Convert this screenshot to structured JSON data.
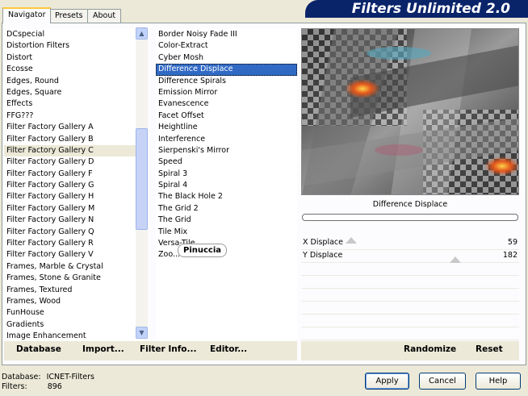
{
  "tabs": [
    {
      "label": "Navigator",
      "active": true
    },
    {
      "label": "Presets",
      "active": false
    },
    {
      "label": "About",
      "active": false
    }
  ],
  "banner": "Filters Unlimited 2.0",
  "categories": [
    "DCspecial",
    "Distortion Filters",
    "Distort",
    "Ecosse",
    "Edges, Round",
    "Edges, Square",
    "Effects",
    "FFG???",
    "Filter Factory Gallery A",
    "Filter Factory Gallery B",
    "Filter Factory Gallery C",
    "Filter Factory Gallery D",
    "Filter Factory Gallery F",
    "Filter Factory Gallery G",
    "Filter Factory Gallery H",
    "Filter Factory Gallery M",
    "Filter Factory Gallery N",
    "Filter Factory Gallery Q",
    "Filter Factory Gallery R",
    "Filter Factory Gallery V",
    "Frames, Marble & Crystal",
    "Frames, Stone & Granite",
    "Frames, Textured",
    "Frames, Wood",
    "FunHouse",
    "Gradients",
    "Image Enhancement"
  ],
  "selected_category": "Filter Factory Gallery C",
  "filters": [
    "Border Noisy Fade III",
    "Color-Extract",
    "Cyber Mosh",
    "Difference Displace",
    "Difference Spirals",
    "Emission Mirror",
    "Evanescence",
    "Facet Offset",
    "Heightline",
    "Interference",
    "Sierpenski's Mirror",
    "Speed",
    "Spiral 3",
    "Spiral 4",
    "The Black Hole 2",
    "The Grid 2",
    "The Grid",
    "Tile Mix",
    "Versa-Tile",
    "Zoo..."
  ],
  "selected_filter": "Difference Displace",
  "watermark": "Pinuccia",
  "bottom_buttons": {
    "database": "Database",
    "import": "Import...",
    "filter_info": "Filter Info...",
    "editor": "Editor...",
    "randomize": "Randomize",
    "reset": "Reset"
  },
  "filter_name": "Difference Displace",
  "params": [
    {
      "label": "X Displace",
      "value": "59"
    },
    {
      "label": "Y Displace",
      "value": "182"
    }
  ],
  "status": {
    "database_label": "Database:",
    "database_value": "ICNET-Filters",
    "filters_label": "Filters:",
    "filters_value": "896"
  },
  "dialog_buttons": {
    "apply": "Apply",
    "cancel": "Cancel",
    "help": "Help"
  }
}
